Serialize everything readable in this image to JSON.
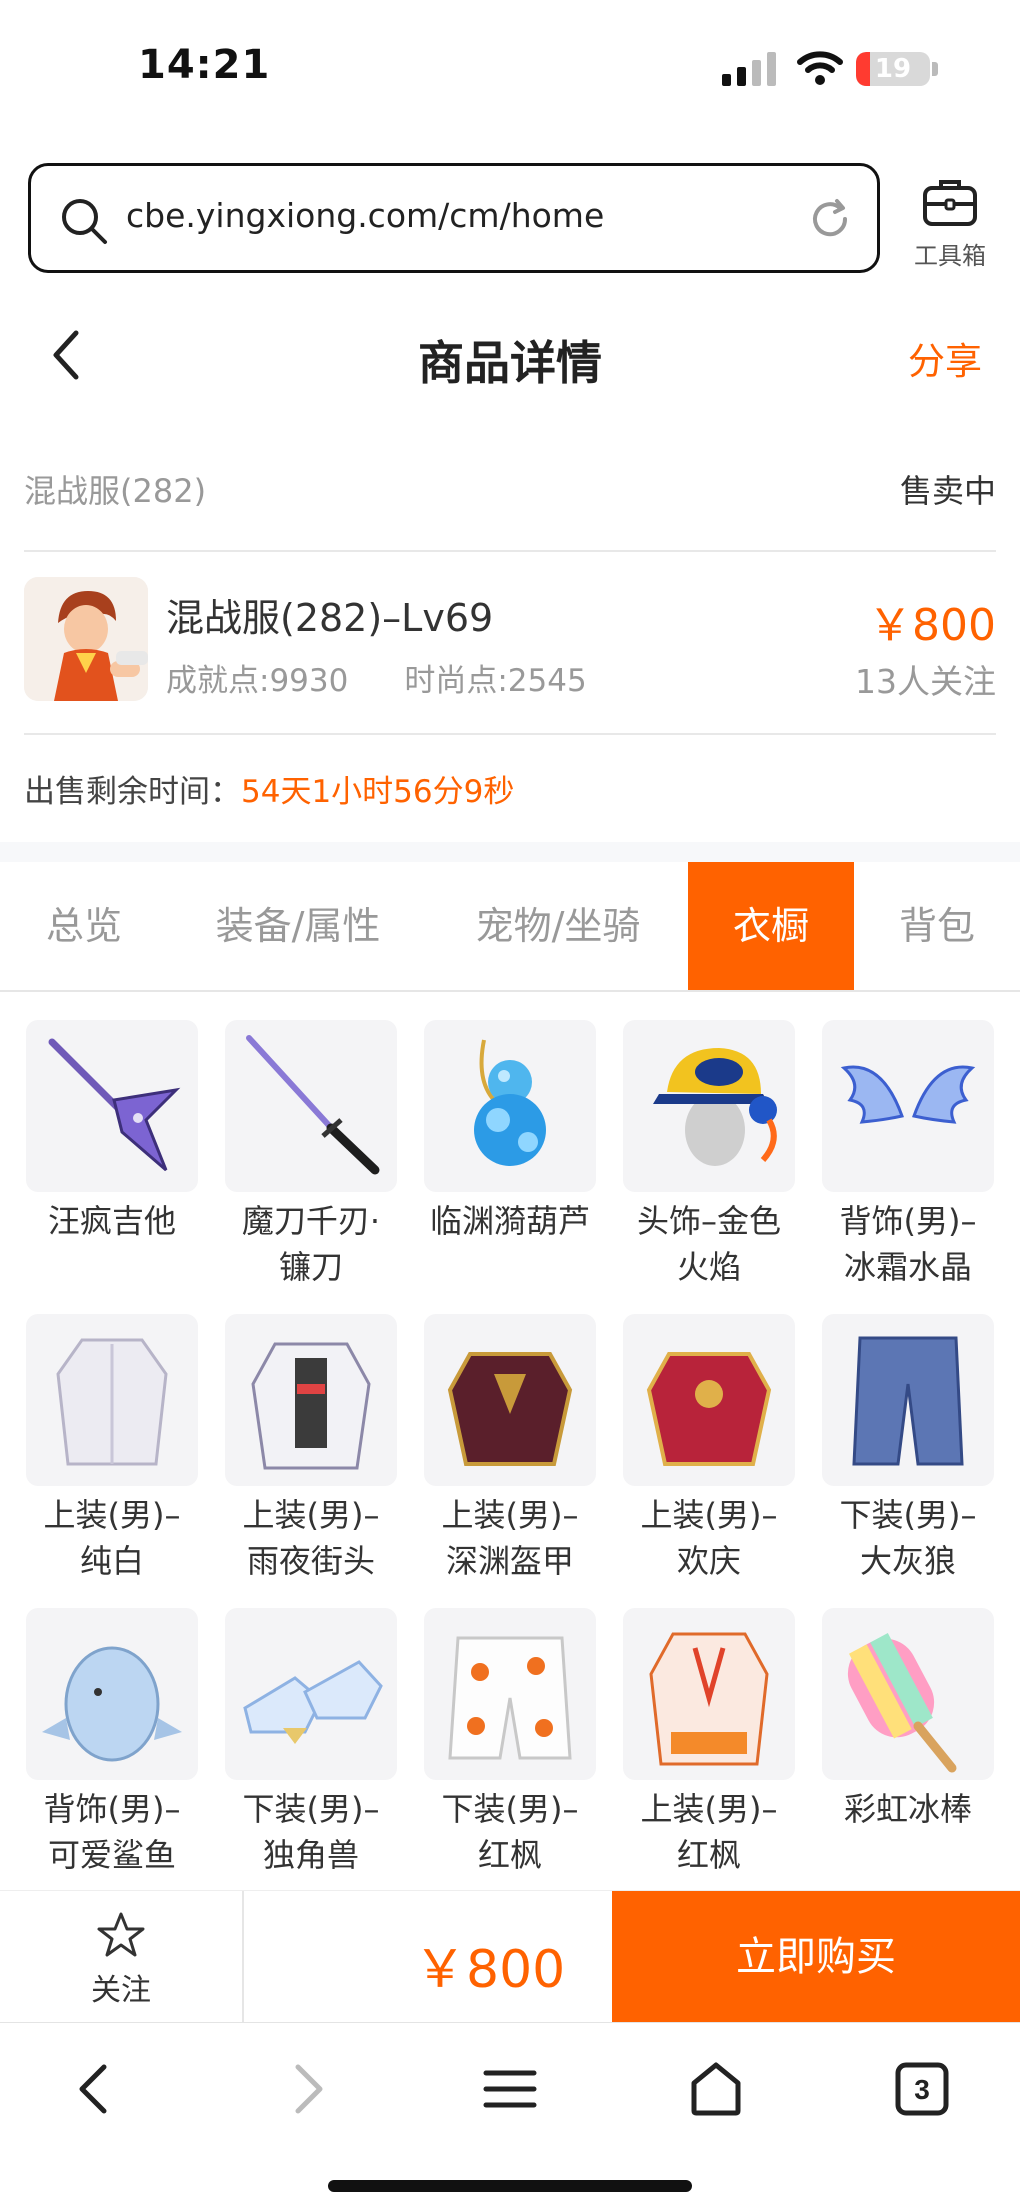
{
  "status_bar": {
    "time": "14:21",
    "battery": "19",
    "battery_level": 0.19
  },
  "browser": {
    "url": "cbe.yingxiong.com/cm/home",
    "toolbox_label": "工具箱",
    "tab_count": "3"
  },
  "header": {
    "title": "商品详情",
    "share": "分享"
  },
  "server": {
    "name": "混战服(282)",
    "status": "售卖中"
  },
  "item": {
    "title": "混战服(282)–Lv69",
    "achievement": "成就点:9930",
    "fashion": "时尚点:2545",
    "price": "￥800",
    "followers": "13人关注"
  },
  "countdown": {
    "label": "出售剩余时间：",
    "value": "54天1小时56分9秒"
  },
  "tabs": [
    {
      "label": "总览"
    },
    {
      "label": "装备/属性"
    },
    {
      "label": "宠物/坐骑"
    },
    {
      "label": "衣橱",
      "active": true
    },
    {
      "label": "背包"
    }
  ],
  "wardrobe": [
    {
      "line1": "汪疯吉他",
      "line2": "",
      "icon": "guitar-icon"
    },
    {
      "line1": "魔刀千刃·",
      "line2": "镰刀",
      "icon": "katana-icon"
    },
    {
      "line1": "临渊漪葫芦",
      "line2": "",
      "icon": "gourd-icon"
    },
    {
      "line1": "头饰–金色",
      "line2": "火焰",
      "icon": "cap-icon"
    },
    {
      "line1": "背饰(男)–",
      "line2": "冰霜水晶",
      "icon": "wings-icon"
    },
    {
      "line1": "上装(男)–",
      "line2": "纯白",
      "icon": "white-coat-icon"
    },
    {
      "line1": "上装(男)–",
      "line2": "雨夜街头",
      "icon": "street-jacket-icon"
    },
    {
      "line1": "上装(男)–",
      "line2": "深渊盔甲",
      "icon": "dark-armor-icon"
    },
    {
      "line1": "上装(男)–",
      "line2": "欢庆",
      "icon": "red-armor-icon"
    },
    {
      "line1": "下装(男)–",
      "line2": "大灰狼",
      "icon": "pants-icon"
    },
    {
      "line1": "背饰(男)–",
      "line2": "可爱鲨鱼",
      "icon": "shark-icon"
    },
    {
      "line1": "下装(男)–",
      "line2": "独角兽",
      "icon": "unicorn-boots-icon"
    },
    {
      "line1": "下装(男)–",
      "line2": "红枫",
      "icon": "maple-shorts-icon"
    },
    {
      "line1": "上装(男)–",
      "line2": "红枫",
      "icon": "maple-robe-icon"
    },
    {
      "line1": "彩虹冰棒",
      "line2": "",
      "icon": "popsicle-icon"
    }
  ],
  "action_bar": {
    "follow": "关注",
    "price": "￥800",
    "buy": "立即购买"
  },
  "colors": {
    "accent": "#ff6200",
    "muted": "#999999",
    "text": "#333333"
  }
}
